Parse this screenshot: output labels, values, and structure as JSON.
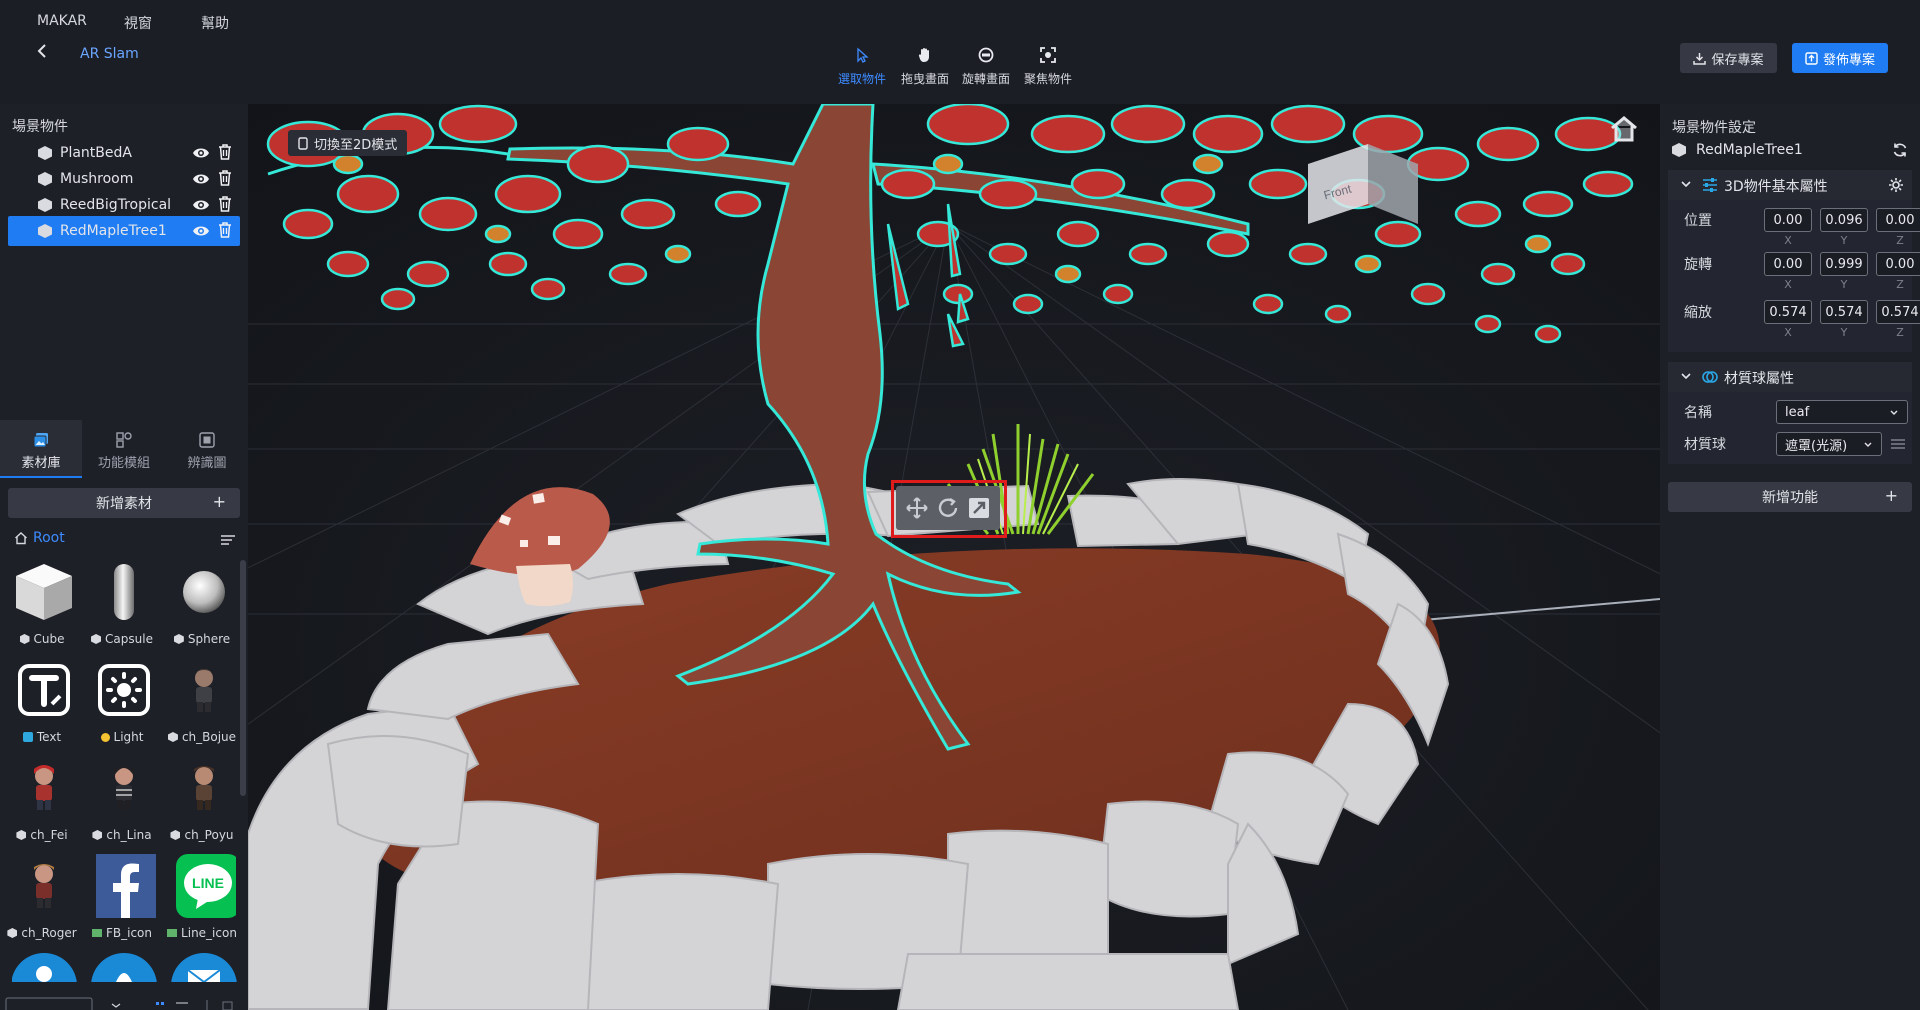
{
  "menu": {
    "app": "MAKAR",
    "window": "視窗",
    "help": "幫助"
  },
  "header": {
    "project_name": "AR Slam"
  },
  "tools": {
    "select": "選取物件",
    "pan": "拖曳畫面",
    "rotate": "旋轉畫面",
    "focus": "聚焦物件"
  },
  "actions": {
    "save": "保存專案",
    "publish": "發佈專案"
  },
  "scene": {
    "title": "場景物件",
    "items": [
      {
        "label": "PlantBedA"
      },
      {
        "label": "Mushroom"
      },
      {
        "label": "ReedBigTropical"
      },
      {
        "label": "RedMapleTree1"
      }
    ]
  },
  "left_tabs": {
    "assets": "素材庫",
    "modules": "功能模組",
    "recognition": "辨識圖"
  },
  "assets": {
    "add_label": "新增素材",
    "add_plus": "+",
    "root_label": "Root",
    "items": [
      {
        "name": "Cube"
      },
      {
        "name": "Capsule"
      },
      {
        "name": "Sphere"
      },
      {
        "name": "Text"
      },
      {
        "name": "Light"
      },
      {
        "name": "ch_Bojue"
      },
      {
        "name": "ch_Fei"
      },
      {
        "name": "ch_Lina"
      },
      {
        "name": "ch_Poyu"
      },
      {
        "name": "ch_Roger"
      },
      {
        "name": "FB_icon"
      },
      {
        "name": "Line_icon"
      }
    ],
    "line_logo_text": "LINE"
  },
  "viewport": {
    "switch_2d": "切換至2D模式",
    "view_cube_label": "Front"
  },
  "inspector": {
    "title": "場景物件設定",
    "object_name": "RedMapleTree1",
    "basic_section": "3D物件基本屬性",
    "position_label": "位置",
    "rotation_label": "旋轉",
    "scale_label": "縮放",
    "axis_x": "X",
    "axis_y": "Y",
    "axis_z": "Z",
    "position": {
      "x": "0.00",
      "y": "0.096",
      "z": "0.00"
    },
    "rotation": {
      "x": "0.00",
      "y": "0.999",
      "z": "0.00"
    },
    "scale": {
      "x": "0.574",
      "y": "0.574",
      "z": "0.574"
    },
    "material_section": "材質球屬性",
    "name_label": "名稱",
    "name_value": "leaf",
    "material_label": "材質球",
    "material_value": "遮罩(光源)",
    "add_feature": "新增功能",
    "add_plus": "+"
  },
  "colors": {
    "accent": "#1f7cf2",
    "outline": "#35e8d8",
    "highlight_box": "#e01b1b"
  }
}
